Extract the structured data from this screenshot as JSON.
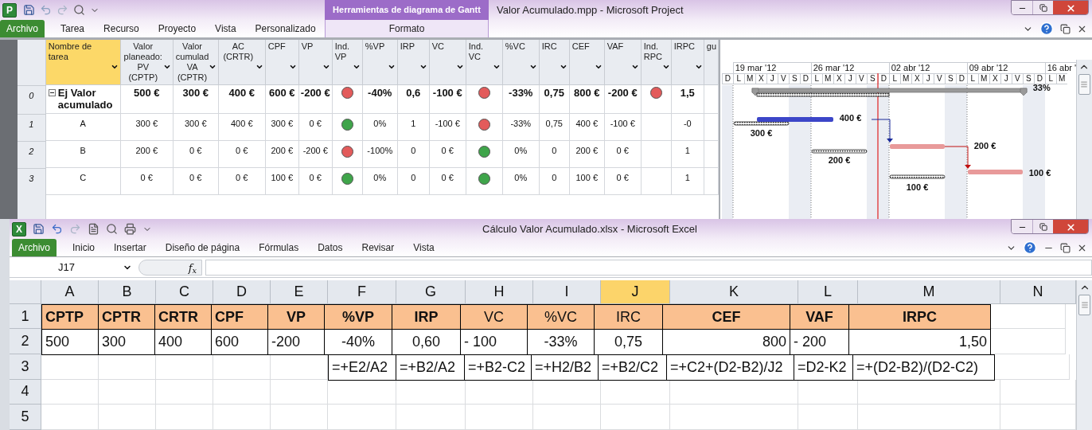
{
  "project": {
    "app_letter": "P",
    "title": "Valor Acumulado.mpp  -  Microsoft Project",
    "contextual_group": "Herramientas de diagrama de Gantt",
    "tabs": [
      {
        "label": "Archivo",
        "kind": "file"
      },
      {
        "label": "Tarea",
        "kind": "tab"
      },
      {
        "label": "Recurso",
        "kind": "tab"
      },
      {
        "label": "Proyecto",
        "kind": "tab"
      },
      {
        "label": "Vista",
        "kind": "tab"
      },
      {
        "label": "Personalizado",
        "kind": "tab"
      }
    ],
    "contextual_tab": "Formato",
    "columns": [
      {
        "lines": [
          "Nombre de",
          "tarea"
        ],
        "selected": true
      },
      {
        "lines": [
          "Valor",
          "planeado:",
          "PV",
          "(CPTP)"
        ],
        "selected": false
      },
      {
        "lines": [
          "Valor",
          "cumulad",
          "VA",
          "(CPTR)"
        ],
        "selected": false
      },
      {
        "lines": [
          "AC",
          "(CRTR)"
        ],
        "selected": false
      },
      {
        "lines": [
          "CPF"
        ],
        "selected": false
      },
      {
        "lines": [
          "VP"
        ],
        "selected": false
      },
      {
        "lines": [
          "Ind.",
          "VP"
        ],
        "selected": false
      },
      {
        "lines": [
          "%VP"
        ],
        "selected": false
      },
      {
        "lines": [
          "IRP"
        ],
        "selected": false
      },
      {
        "lines": [
          "VC"
        ],
        "selected": false
      },
      {
        "lines": [
          "Ind.",
          "VC"
        ],
        "selected": false
      },
      {
        "lines": [
          "%VC"
        ],
        "selected": false
      },
      {
        "lines": [
          "IRC"
        ],
        "selected": false
      },
      {
        "lines": [
          "CEF"
        ],
        "selected": false
      },
      {
        "lines": [
          "VAF"
        ],
        "selected": false
      },
      {
        "lines": [
          "Ind.",
          "RPC"
        ],
        "selected": false
      },
      {
        "lines": [
          "IRPC"
        ],
        "selected": false
      },
      {
        "lines": [
          "gu"
        ],
        "selected": false
      }
    ],
    "rows": [
      {
        "id": "0",
        "summary": true,
        "expanded": true,
        "cells": [
          {
            "kind": "name",
            "text": "Ej Valor acumulado"
          },
          {
            "kind": "text",
            "text": "500 €"
          },
          {
            "kind": "text",
            "text": "300 €"
          },
          {
            "kind": "text",
            "text": "400 €"
          },
          {
            "kind": "text",
            "text": "600 €"
          },
          {
            "kind": "text",
            "text": "-200 €"
          },
          {
            "kind": "indicator",
            "color": "#e35b5b"
          },
          {
            "kind": "text",
            "text": "-40%"
          },
          {
            "kind": "text",
            "text": "0,6"
          },
          {
            "kind": "text",
            "text": "-100 €"
          },
          {
            "kind": "indicator",
            "color": "#e35b5b"
          },
          {
            "kind": "text",
            "text": "-33%"
          },
          {
            "kind": "text",
            "text": "0,75"
          },
          {
            "kind": "text",
            "text": "800 €"
          },
          {
            "kind": "text",
            "text": "-200 €"
          },
          {
            "kind": "indicator",
            "color": "#e35b5b"
          },
          {
            "kind": "text",
            "text": "1,5"
          },
          {
            "kind": "empty"
          }
        ]
      },
      {
        "id": "1",
        "summary": false,
        "cells": [
          {
            "kind": "name",
            "text": "A"
          },
          {
            "kind": "text",
            "text": "300 €"
          },
          {
            "kind": "text",
            "text": "300 €"
          },
          {
            "kind": "text",
            "text": "400 €"
          },
          {
            "kind": "text",
            "text": "300 €"
          },
          {
            "kind": "text",
            "text": "0 €"
          },
          {
            "kind": "indicator",
            "color": "#3fa54a"
          },
          {
            "kind": "text",
            "text": "0%"
          },
          {
            "kind": "text",
            "text": "1"
          },
          {
            "kind": "text",
            "text": "-100 €"
          },
          {
            "kind": "indicator",
            "color": "#e35b5b"
          },
          {
            "kind": "text",
            "text": "-33%"
          },
          {
            "kind": "text",
            "text": "0,75"
          },
          {
            "kind": "text",
            "text": "400 €"
          },
          {
            "kind": "text",
            "text": "-100 €"
          },
          {
            "kind": "empty"
          },
          {
            "kind": "text",
            "text": "-0"
          },
          {
            "kind": "empty"
          }
        ]
      },
      {
        "id": "2",
        "summary": false,
        "cells": [
          {
            "kind": "name",
            "text": "B"
          },
          {
            "kind": "text",
            "text": "200 €"
          },
          {
            "kind": "text",
            "text": "0 €"
          },
          {
            "kind": "text",
            "text": "0 €"
          },
          {
            "kind": "text",
            "text": "200 €"
          },
          {
            "kind": "text",
            "text": "-200 €"
          },
          {
            "kind": "indicator",
            "color": "#e35b5b"
          },
          {
            "kind": "text",
            "text": "-100%"
          },
          {
            "kind": "text",
            "text": "0"
          },
          {
            "kind": "text",
            "text": "0 €"
          },
          {
            "kind": "indicator",
            "color": "#3fa54a"
          },
          {
            "kind": "text",
            "text": "0%"
          },
          {
            "kind": "text",
            "text": "0"
          },
          {
            "kind": "text",
            "text": "200 €"
          },
          {
            "kind": "text",
            "text": "0 €"
          },
          {
            "kind": "empty"
          },
          {
            "kind": "text",
            "text": "1"
          },
          {
            "kind": "empty"
          }
        ]
      },
      {
        "id": "3",
        "summary": false,
        "cells": [
          {
            "kind": "name",
            "text": "C"
          },
          {
            "kind": "text",
            "text": "0 €"
          },
          {
            "kind": "text",
            "text": "0 €"
          },
          {
            "kind": "text",
            "text": "0 €"
          },
          {
            "kind": "text",
            "text": "100 €"
          },
          {
            "kind": "text",
            "text": "0 €"
          },
          {
            "kind": "indicator",
            "color": "#3fa54a"
          },
          {
            "kind": "text",
            "text": "0%"
          },
          {
            "kind": "text",
            "text": "0"
          },
          {
            "kind": "text",
            "text": "0 €"
          },
          {
            "kind": "indicator",
            "color": "#3fa54a"
          },
          {
            "kind": "text",
            "text": "0%"
          },
          {
            "kind": "text",
            "text": "0"
          },
          {
            "kind": "text",
            "text": "100 €"
          },
          {
            "kind": "text",
            "text": "0 €"
          },
          {
            "kind": "empty"
          },
          {
            "kind": "text",
            "text": "1"
          },
          {
            "kind": "empty"
          }
        ]
      }
    ],
    "gantt": {
      "weeks": [
        "19 mar '12",
        "26 mar '12",
        "02 abr '12",
        "09 abr '12",
        "16 abr '"
      ],
      "days": [
        "D",
        "L",
        "M",
        "X",
        "J",
        "V",
        "S",
        "D",
        "L",
        "M",
        "X",
        "J",
        "V",
        "S",
        "D",
        "L",
        "M",
        "X",
        "J",
        "V",
        "S",
        "D",
        "L",
        "M",
        "X",
        "J",
        "V",
        "S",
        "D",
        "L",
        "M"
      ],
      "summary_label": "33%",
      "tasks": [
        {
          "bar_label": "400 €",
          "baseline_label": "300 €",
          "color": "#3c46c8"
        },
        {
          "bar_label": "200 €",
          "baseline_label": "200 €",
          "color": "#e89a9a"
        },
        {
          "bar_label": "100 €",
          "baseline_label": "100 €",
          "color": "#e89a9a"
        }
      ]
    }
  },
  "excel": {
    "app_letter": "X",
    "title": "Cálculo Valor Acumulado.xlsx  -  Microsoft Excel",
    "tabs": [
      {
        "label": "Archivo",
        "kind": "file"
      },
      {
        "label": "Inicio",
        "kind": "tab"
      },
      {
        "label": "Insertar",
        "kind": "tab"
      },
      {
        "label": "Diseño de página",
        "kind": "tab"
      },
      {
        "label": "Fórmulas",
        "kind": "tab"
      },
      {
        "label": "Datos",
        "kind": "tab"
      },
      {
        "label": "Revisar",
        "kind": "tab"
      },
      {
        "label": "Vista",
        "kind": "tab"
      }
    ],
    "name_box": "J17",
    "function_label": "f$_{x}$",
    "columns": [
      {
        "label": "A",
        "selected": false
      },
      {
        "label": "B",
        "selected": false
      },
      {
        "label": "C",
        "selected": false
      },
      {
        "label": "D",
        "selected": false
      },
      {
        "label": "E",
        "selected": false
      },
      {
        "label": "F",
        "selected": false
      },
      {
        "label": "G",
        "selected": false
      },
      {
        "label": "H",
        "selected": false
      },
      {
        "label": "I",
        "selected": false
      },
      {
        "label": "J",
        "selected": true
      },
      {
        "label": "K",
        "selected": false
      },
      {
        "label": "L",
        "selected": false
      },
      {
        "label": "M",
        "selected": false
      },
      {
        "label": "N",
        "selected": false
      }
    ],
    "rows": [
      {
        "label": "1",
        "kind": "header",
        "cells": [
          {
            "kind": "value",
            "text": "CPTP",
            "bold": true
          },
          {
            "kind": "value",
            "text": "CPTR",
            "bold": true
          },
          {
            "kind": "value",
            "text": "CRTR",
            "bold": true
          },
          {
            "kind": "value",
            "text": "CPF",
            "bold": true
          },
          {
            "kind": "value",
            "text": "VP",
            "bold": true
          },
          {
            "kind": "value",
            "text": "%VP",
            "bold": true
          },
          {
            "kind": "value",
            "text": "IRP",
            "bold": true
          },
          {
            "kind": "value",
            "text": "VC",
            "bold": false
          },
          {
            "kind": "value",
            "text": "%VC",
            "bold": false
          },
          {
            "kind": "value",
            "text": "IRC",
            "bold": false
          },
          {
            "kind": "value",
            "text": "CEF",
            "bold": true
          },
          {
            "kind": "value",
            "text": "VAF",
            "bold": true
          },
          {
            "kind": "value",
            "text": "IRPC",
            "bold": true
          },
          {
            "kind": "empty"
          }
        ]
      },
      {
        "label": "2",
        "kind": "data",
        "cells": [
          {
            "kind": "value",
            "text": "500"
          },
          {
            "kind": "value",
            "text": "300"
          },
          {
            "kind": "value",
            "text": "400"
          },
          {
            "kind": "value",
            "text": "600"
          },
          {
            "kind": "value",
            "text": "-200"
          },
          {
            "kind": "value",
            "text": "-40%"
          },
          {
            "kind": "value",
            "text": "0,60"
          },
          {
            "kind": "value",
            "text": "-   100"
          },
          {
            "kind": "value",
            "text": "-33%"
          },
          {
            "kind": "value",
            "text": "0,75"
          },
          {
            "kind": "value",
            "text": "800"
          },
          {
            "kind": "value",
            "text": "- 200"
          },
          {
            "kind": "value",
            "text": "1,50"
          },
          {
            "kind": "empty"
          }
        ]
      },
      {
        "label": "3",
        "kind": "data",
        "cells": [
          {
            "kind": "empty"
          },
          {
            "kind": "empty"
          },
          {
            "kind": "empty"
          },
          {
            "kind": "empty"
          },
          {
            "kind": "empty"
          },
          {
            "kind": "value",
            "text": "=+E2/A2"
          },
          {
            "kind": "value",
            "text": "=+B2/A2"
          },
          {
            "kind": "value",
            "text": "=+B2-C2"
          },
          {
            "kind": "value",
            "text": "=+H2/B2"
          },
          {
            "kind": "value",
            "text": "=+B2/C2"
          },
          {
            "kind": "value",
            "text": "=+C2+(D2-B2)/J2"
          },
          {
            "kind": "value",
            "text": "=D2-K2"
          },
          {
            "kind": "value",
            "text": "=+(D2-B2)/(D2-C2)"
          },
          {
            "kind": "empty"
          }
        ]
      },
      {
        "label": "4"
      },
      {
        "label": "5"
      }
    ]
  }
}
